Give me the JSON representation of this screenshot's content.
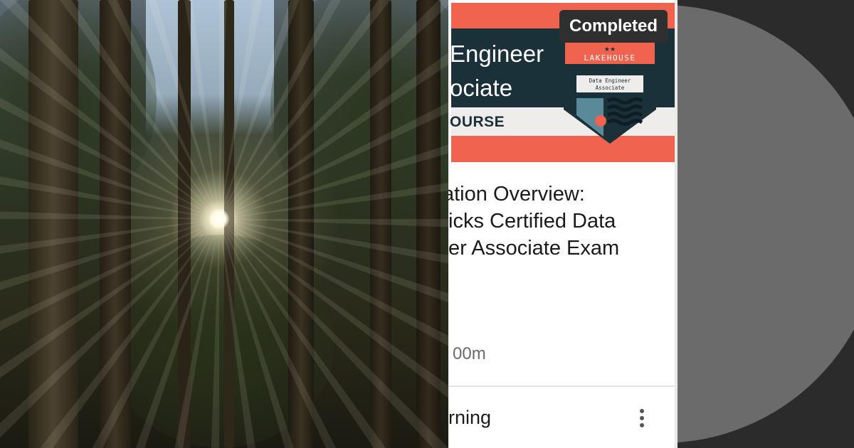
{
  "card": {
    "thumbnail_title": "Engineer\nociate",
    "thumbnail_kind": "OURSE",
    "status_tag": "Completed",
    "badge": {
      "brand": "LAKEHOUSE",
      "subtitle": "Data Engineer\nAssociate",
      "stars": "★★"
    },
    "title": "ation Overview:\nicks Certified Data\ner Associate Exam",
    "duration": "00m",
    "provider": "rning",
    "more_label": "⋮"
  },
  "colors": {
    "coral": "#f0634f",
    "navy": "#1b3139",
    "status_tag_bg": "#2f2f2f",
    "disc": "#6b6b6b",
    "background": "#2b2b2b"
  }
}
